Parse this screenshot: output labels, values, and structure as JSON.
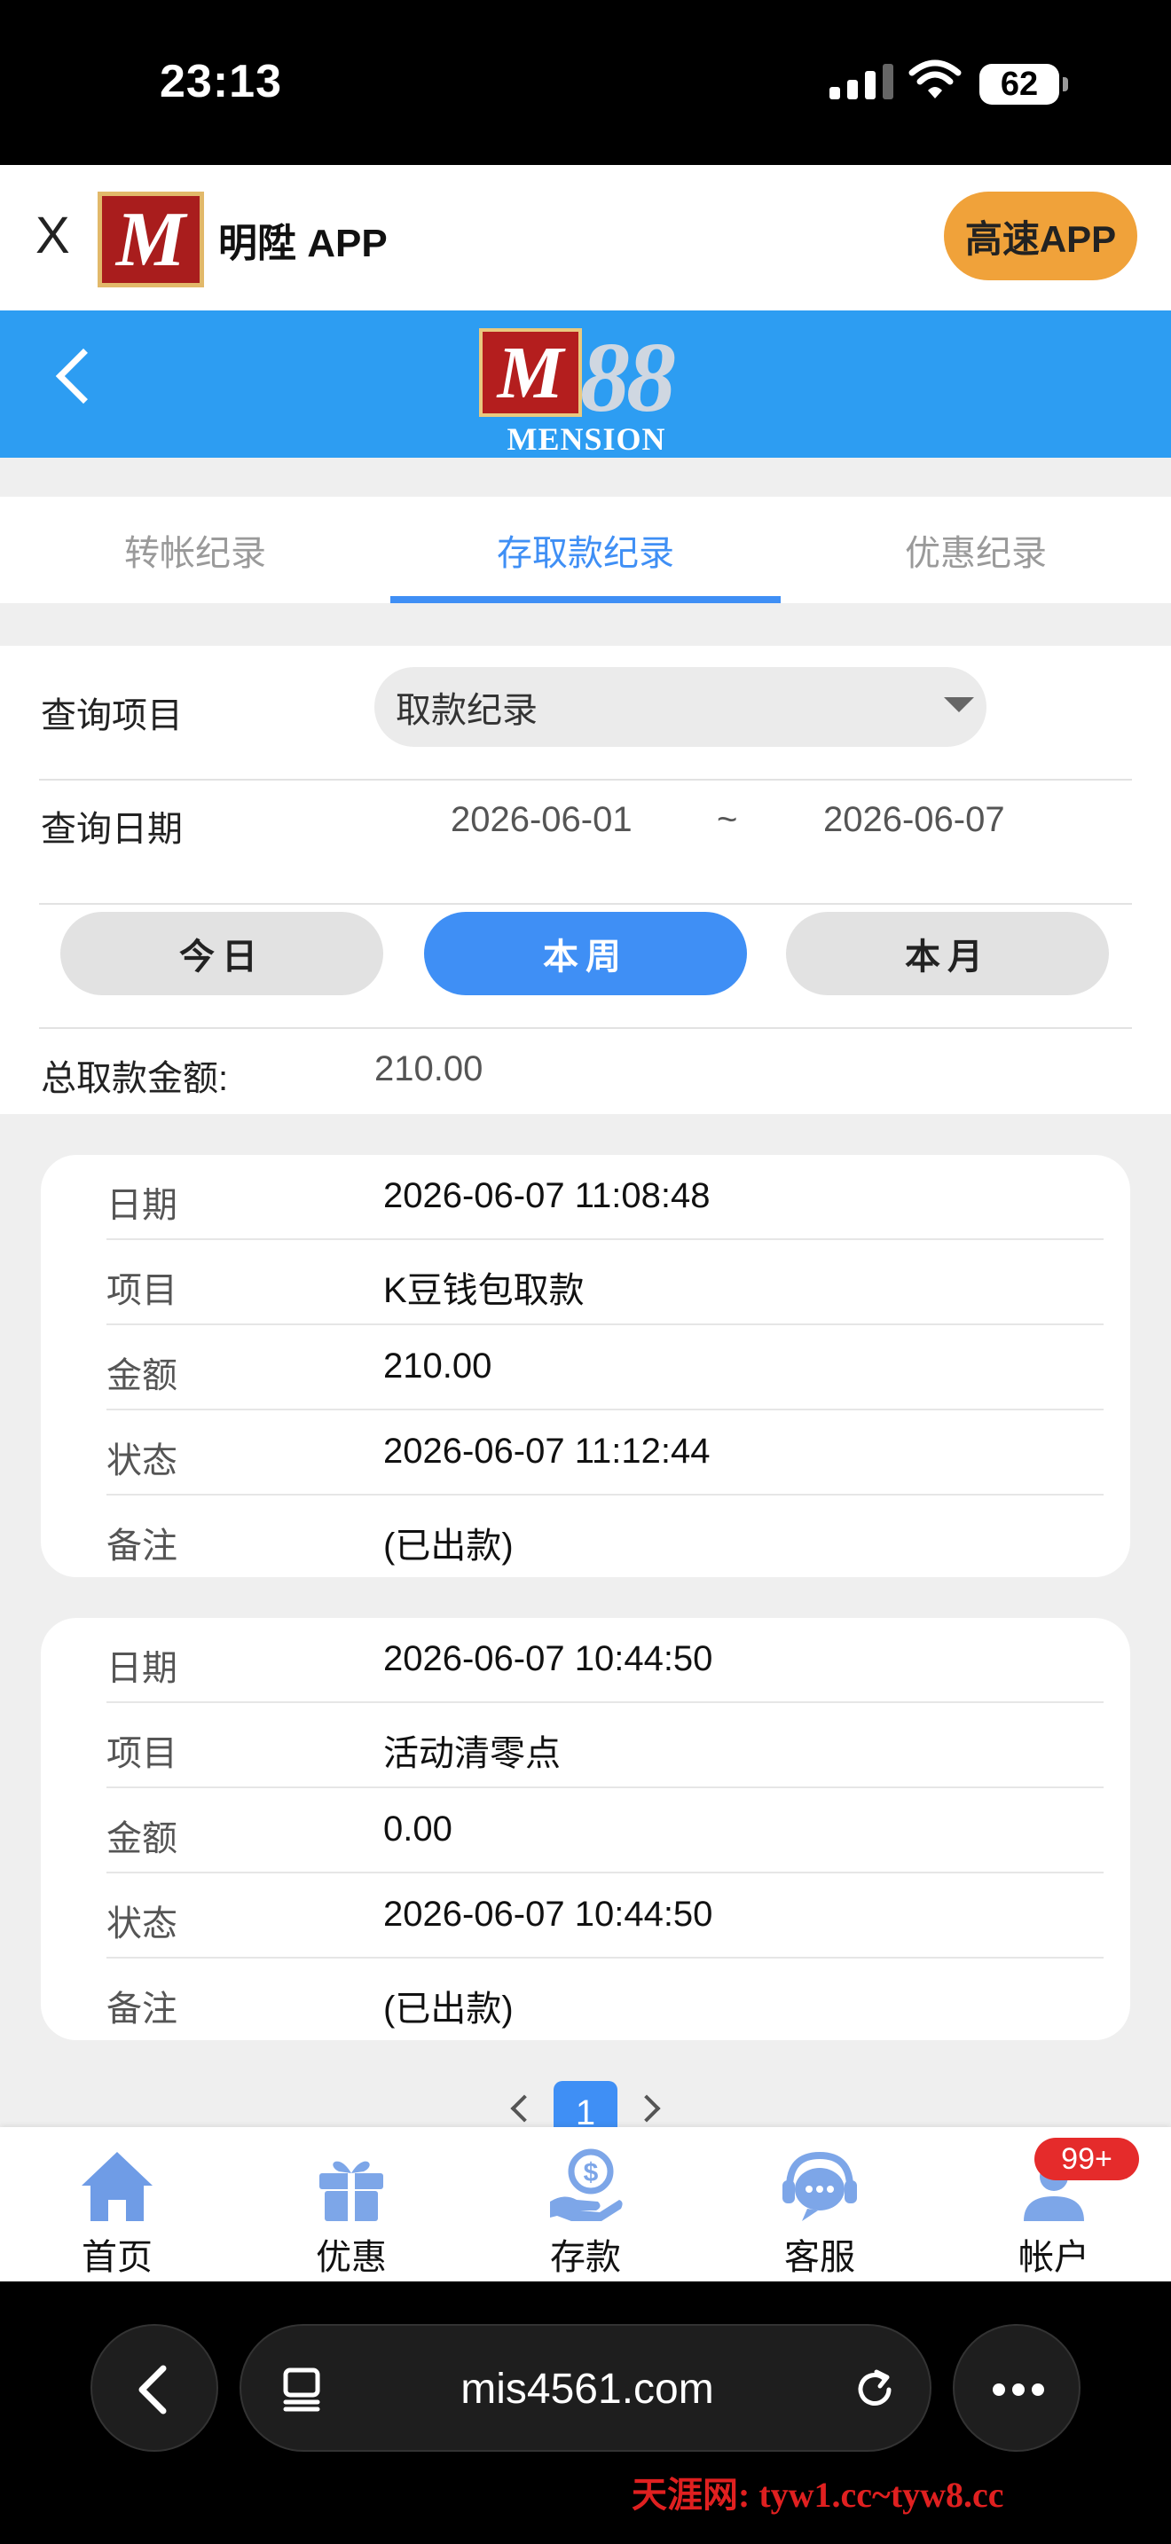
{
  "status": {
    "time": "23:13",
    "battery": "62"
  },
  "appbar": {
    "close": "X",
    "title": "明陞 APP",
    "speed_button": "高速APP"
  },
  "brand": {
    "number": "88",
    "name": "MENSION",
    "logo_letter": "M"
  },
  "tabs": [
    {
      "label": "转帐纪录"
    },
    {
      "label": "存取款纪录"
    },
    {
      "label": "优惠纪录"
    }
  ],
  "query": {
    "item_label": "查询项目",
    "item_value": "取款纪录",
    "date_label": "查询日期",
    "date_from": "2026-06-01",
    "date_sep": "~",
    "date_to": "2026-06-07",
    "quick": [
      "今日",
      "本周",
      "本月"
    ],
    "total_label": "总取款金额:",
    "total_value": "210.00"
  },
  "records": [
    {
      "rows": [
        {
          "label": "日期",
          "value": "2026-06-07 11:08:48"
        },
        {
          "label": "项目",
          "value": "K豆钱包取款"
        },
        {
          "label": "金额",
          "value": "210.00"
        },
        {
          "label": "状态",
          "value": "2026-06-07 11:12:44"
        },
        {
          "label": "备注",
          "value": "(已出款)"
        }
      ]
    },
    {
      "rows": [
        {
          "label": "日期",
          "value": "2026-06-07 10:44:50"
        },
        {
          "label": "项目",
          "value": "活动清零点"
        },
        {
          "label": "金额",
          "value": "0.00"
        },
        {
          "label": "状态",
          "value": "2026-06-07 10:44:50"
        },
        {
          "label": "备注",
          "value": "(已出款)"
        }
      ]
    }
  ],
  "pager": {
    "current": "1"
  },
  "nav": [
    {
      "label": "首页",
      "icon": "home-icon"
    },
    {
      "label": "优惠",
      "icon": "gift-icon"
    },
    {
      "label": "存款",
      "icon": "deposit-icon"
    },
    {
      "label": "客服",
      "icon": "support-icon"
    },
    {
      "label": "帐户",
      "icon": "account-icon",
      "badge": "99+"
    }
  ],
  "browser": {
    "url": "mis4561.com"
  },
  "watermark": "天涯网: tyw1.cc~tyw8.cc",
  "colors": {
    "accent": "#3f8ff5",
    "header_blue": "#2d9df2",
    "speed_orange": "#f0a23a",
    "badge_red": "#e52b2b"
  }
}
